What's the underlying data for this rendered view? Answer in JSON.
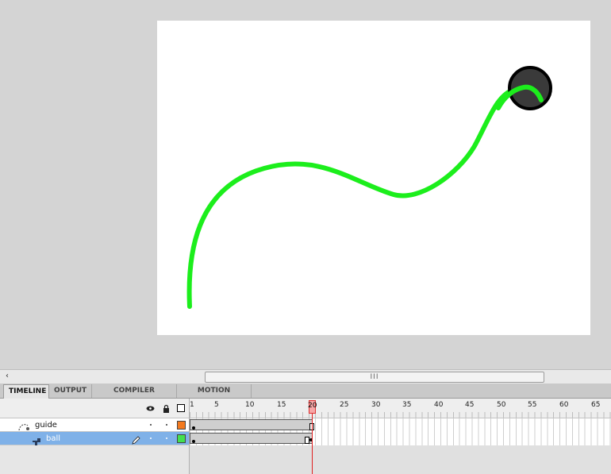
{
  "stage": {
    "guide_color": "#1cee1c",
    "ball_color": "#3a3a3a"
  },
  "scrollbar": {
    "left_arrow": "‹",
    "grip": "III"
  },
  "panel_tabs": [
    "TIMELINE",
    "OUTPUT",
    "COMPILER ERRORS",
    "MOTION EDITOR"
  ],
  "timeline": {
    "header_icons": [
      "eye-icon",
      "lock-icon",
      "outline-icon"
    ],
    "frame_numbers": [
      "1",
      "5",
      "10",
      "15",
      "20",
      "25",
      "30",
      "35",
      "40",
      "45",
      "50",
      "55",
      "60",
      "65"
    ],
    "current_frame": "20",
    "layers": [
      {
        "name": "guide",
        "icon": "motion-guide-icon",
        "color": "#f47a1f"
      },
      {
        "name": "ball",
        "icon": "layer-icon",
        "color": "#43e04e",
        "selected": true,
        "edit_icon": "pencil-icon"
      }
    ]
  }
}
